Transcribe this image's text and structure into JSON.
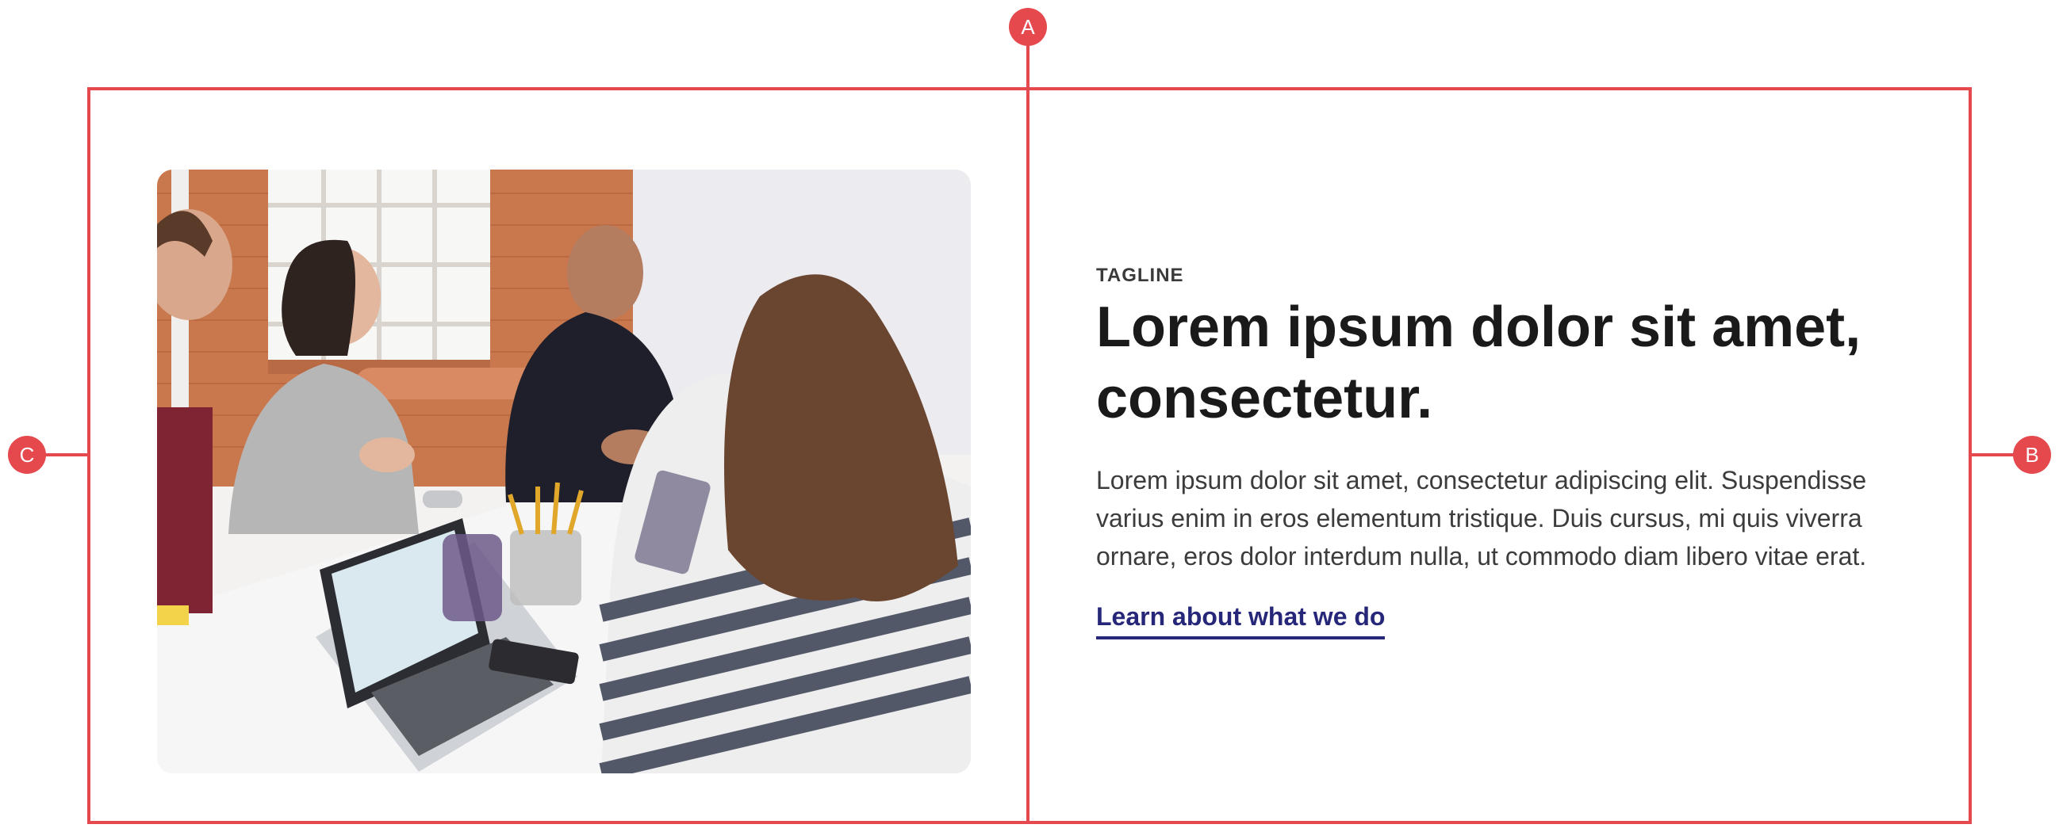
{
  "annotations": {
    "a": "A",
    "b": "B",
    "c": "C",
    "color": "#e5484d"
  },
  "hero": {
    "tagline": "TAGLINE",
    "heading": "Lorem ipsum dolor sit amet, consectetur.",
    "body": "Lorem ipsum dolor sit amet, consectetur adipiscing elit. Suspendisse varius enim in eros elementum tristique. Duis cursus, mi quis viverra ornare, eros dolor interdum nulla, ut commodo diam libero vitae erat.",
    "cta_label": "Learn about what we do",
    "cta_color": "#27277a"
  }
}
